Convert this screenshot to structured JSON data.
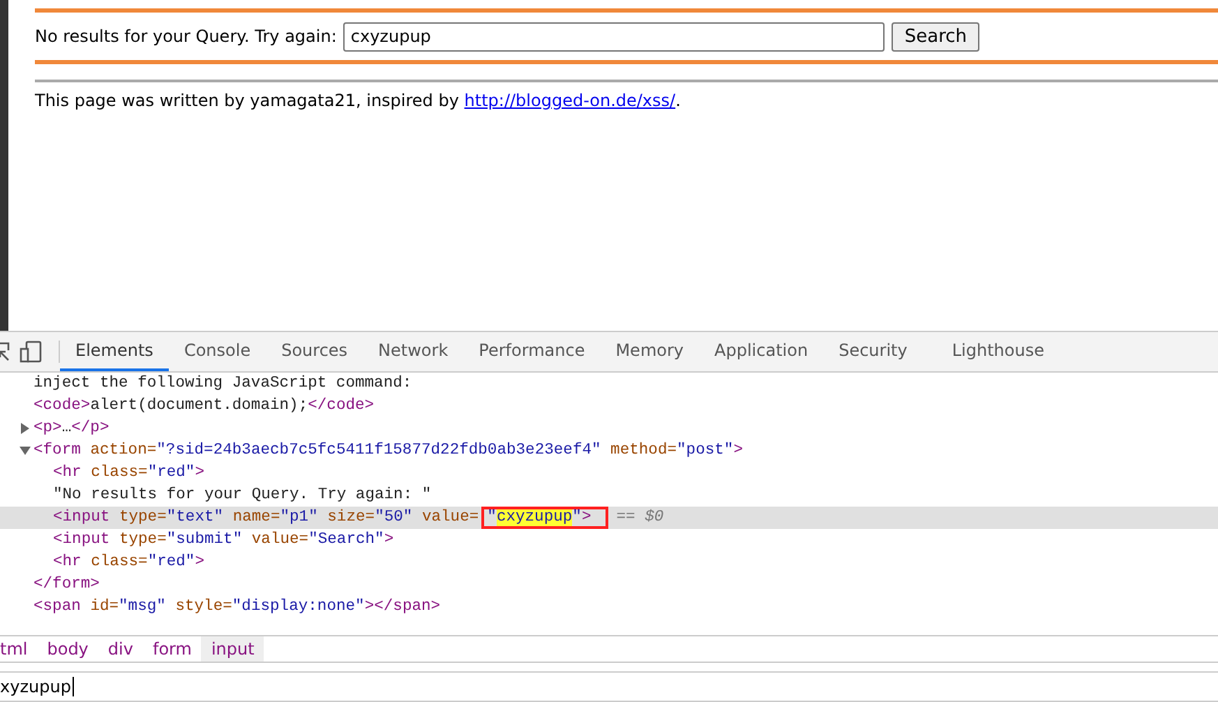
{
  "page": {
    "form": {
      "label": "No results for your Query. Try again:",
      "value": "cxyzupup",
      "button": "Search"
    },
    "footer": {
      "text": "This page was written by yamagata21, inspired by ",
      "link": "http://blogged-on.de/xss/",
      "after": "."
    }
  },
  "devtools": {
    "tabs": [
      {
        "label": "Elements",
        "selected": true
      },
      {
        "label": "Console",
        "selected": false
      },
      {
        "label": "Sources",
        "selected": false
      },
      {
        "label": "Network",
        "selected": false
      },
      {
        "label": "Performance",
        "selected": false
      },
      {
        "label": "Memory",
        "selected": false
      },
      {
        "label": "Application",
        "selected": false
      },
      {
        "label": "Security",
        "selected": false
      },
      {
        "label": "Lighthouse",
        "selected": false
      }
    ],
    "dom_nodes": [
      {
        "selected": false,
        "parts": [
          {
            "kind": "text",
            "text": "inject the following JavaScript command:"
          }
        ]
      },
      {
        "selected": false,
        "parts": [
          {
            "kind": "tag",
            "text": "<code>"
          },
          {
            "kind": "text",
            "text": "alert(document.domain);"
          },
          {
            "kind": "tag",
            "text": "</code>"
          }
        ]
      },
      {
        "selected": false,
        "expanded": false,
        "parts": [
          {
            "kind": "tag",
            "text": "<p>"
          },
          {
            "kind": "text",
            "text": "…"
          },
          {
            "kind": "tag",
            "text": "</p>"
          }
        ]
      },
      {
        "selected": false,
        "expanded": true,
        "closing": "</form>",
        "parts": [
          {
            "kind": "tag",
            "text": "<form "
          },
          {
            "kind": "attr",
            "text": "action="
          },
          {
            "kind": "value",
            "text": "\"?sid=24b3aecb7c5fc5411f15877d22fdb0ab3e23eef4\""
          },
          {
            "kind": "attr",
            "text": " method="
          },
          {
            "kind": "value",
            "text": "\"post\""
          },
          {
            "kind": "tag",
            "text": ">"
          }
        ],
        "children": [
          {
            "selected": false,
            "parts": [
              {
                "kind": "tag",
                "text": "<hr "
              },
              {
                "kind": "attr",
                "text": "class="
              },
              {
                "kind": "value",
                "text": "\"red\""
              },
              {
                "kind": "tag",
                "text": ">"
              }
            ]
          },
          {
            "selected": false,
            "parts": [
              {
                "kind": "text",
                "text": "\"No results for your Query. Try again: \""
              }
            ]
          },
          {
            "selected": true,
            "suffix": "== $0",
            "parts": [
              {
                "kind": "tag",
                "text": "<input "
              },
              {
                "kind": "attr",
                "text": "type="
              },
              {
                "kind": "value",
                "text": "\"text\""
              },
              {
                "kind": "attr",
                "text": " name="
              },
              {
                "kind": "value",
                "text": "\"p1\""
              },
              {
                "kind": "attr",
                "text": " size="
              },
              {
                "kind": "value",
                "text": "\"50\""
              },
              {
                "kind": "attr",
                "text": " value="
              },
              {
                "kind": "boxed",
                "parts": [
                  {
                    "kind": "value",
                    "text": "\""
                  },
                  {
                    "kind": "match",
                    "text": "cxyzupup"
                  },
                  {
                    "kind": "value",
                    "text": "\""
                  },
                  {
                    "kind": "tag",
                    "text": ">"
                  }
                ]
              }
            ]
          },
          {
            "selected": false,
            "parts": [
              {
                "kind": "tag",
                "text": "<input "
              },
              {
                "kind": "attr",
                "text": "type="
              },
              {
                "kind": "value",
                "text": "\"submit\""
              },
              {
                "kind": "attr",
                "text": " value="
              },
              {
                "kind": "value",
                "text": "\"Search\""
              },
              {
                "kind": "tag",
                "text": ">"
              }
            ]
          },
          {
            "selected": false,
            "parts": [
              {
                "kind": "tag",
                "text": "<hr "
              },
              {
                "kind": "attr",
                "text": "class="
              },
              {
                "kind": "value",
                "text": "\"red\""
              },
              {
                "kind": "tag",
                "text": ">"
              }
            ]
          }
        ]
      },
      {
        "selected": false,
        "parts": [
          {
            "kind": "tag",
            "text": "<span "
          },
          {
            "kind": "attr",
            "text": "id="
          },
          {
            "kind": "value",
            "text": "\"msg\""
          },
          {
            "kind": "attr",
            "text": " style="
          },
          {
            "kind": "value",
            "text": "\"display:none\""
          },
          {
            "kind": "tag",
            "text": "></span>"
          }
        ]
      }
    ],
    "breadcrumbs": [
      {
        "label": "tml",
        "selected": false
      },
      {
        "label": "body",
        "selected": false
      },
      {
        "label": "div",
        "selected": false
      },
      {
        "label": "form",
        "selected": false
      },
      {
        "label": "input",
        "selected": true
      }
    ],
    "console_input": "xyzupup"
  }
}
